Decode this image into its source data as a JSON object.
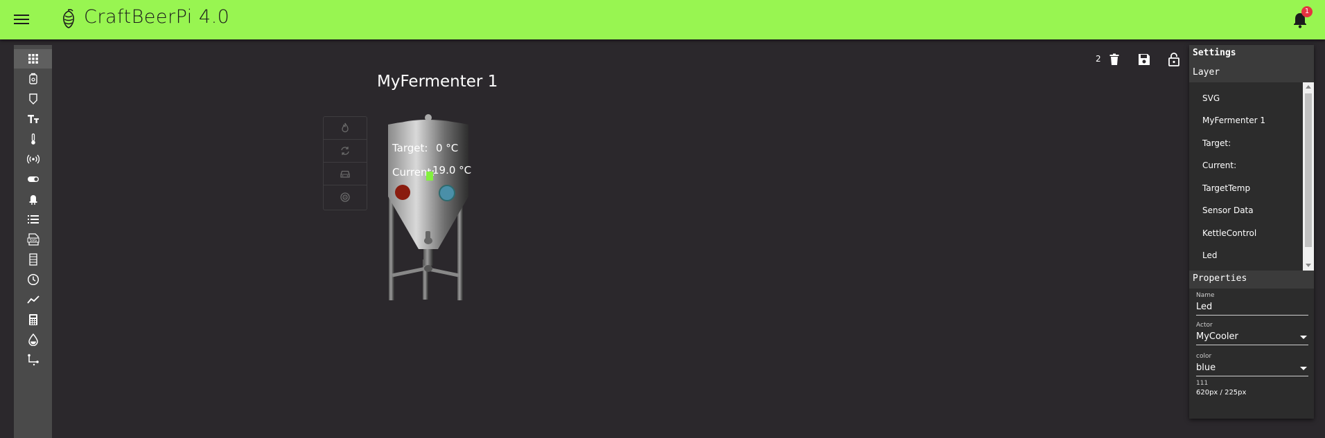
{
  "app": {
    "title": "CraftBeerPi 4.0",
    "notification_count": "1",
    "colors": {
      "appbar": "#98f551",
      "background": "#2b282c",
      "badge": "#e53341"
    }
  },
  "toolbar": {
    "items": [
      {
        "icon": "dashboard-grid-icon",
        "active": true
      },
      {
        "icon": "kettle-icon"
      },
      {
        "icon": "fermenter-icon"
      },
      {
        "icon": "text-icon"
      },
      {
        "icon": "thermometer-icon"
      },
      {
        "icon": "broadcast-icon"
      },
      {
        "icon": "toggle-icon"
      },
      {
        "icon": "led-icon"
      },
      {
        "icon": "list-icon"
      },
      {
        "icon": "svg-file-icon"
      },
      {
        "icon": "table-icon"
      },
      {
        "icon": "clock-icon"
      },
      {
        "icon": "chart-icon"
      },
      {
        "icon": "calculator-icon"
      },
      {
        "icon": "drop-icon"
      },
      {
        "icon": "path-icon"
      }
    ]
  },
  "canvas": {
    "selected_count": "2",
    "widget_title": "MyFermenter 1",
    "target_label": "Target:",
    "target_value": "0 °C",
    "current_label": "Current:",
    "current_value": "19.0 °C"
  },
  "settings": {
    "title": "Settings",
    "layer_title": "Layer",
    "layers": [
      "SVG",
      "MyFermenter 1",
      "Target:",
      "Current:",
      "TargetTemp",
      "Sensor Data",
      "KettleControl",
      "Led"
    ],
    "properties_title": "Properties",
    "name_label": "Name",
    "name_value": "Led",
    "actor_label": "Actor",
    "actor_value": "MyCooler",
    "color_label": "color",
    "color_value": "blue",
    "position_label": "111",
    "position_value": "620px / 225px"
  }
}
